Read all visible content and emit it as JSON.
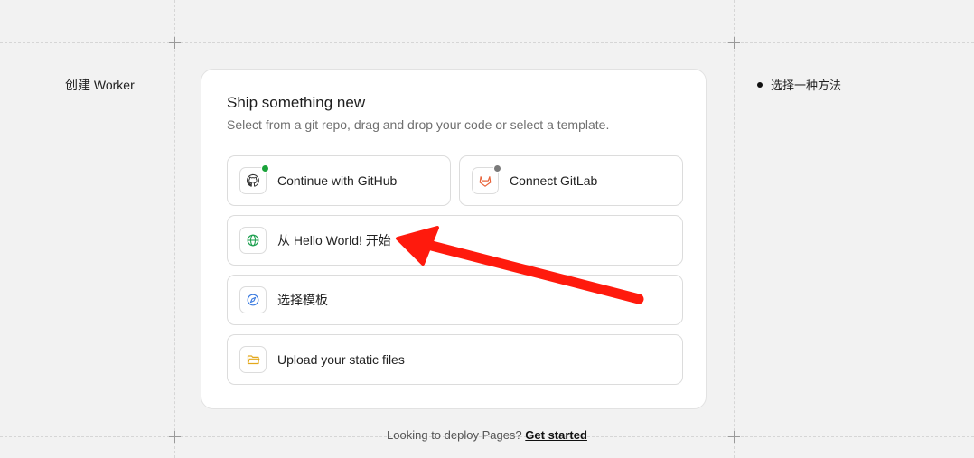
{
  "sidebar_left": {
    "label": "创建 Worker"
  },
  "steps": {
    "current": "选择一种方法"
  },
  "card": {
    "title": "Ship something new",
    "subtitle": "Select from a git repo, drag and drop your code or select a template.",
    "options": {
      "github": {
        "label": "Continue with GitHub",
        "icon": "github-icon",
        "status_color": "#1aa33a"
      },
      "gitlab": {
        "label": "Connect GitLab",
        "icon": "gitlab-icon",
        "status_color": "#7a7a7a"
      },
      "hello_world": {
        "label": "从 Hello World! 开始",
        "icon": "globe-icon"
      },
      "template": {
        "label": "选择模板",
        "icon": "compass-icon"
      },
      "upload": {
        "label": "Upload your static files",
        "icon": "folder-icon"
      }
    }
  },
  "footer": {
    "text": "Looking to deploy Pages?",
    "link": "Get started"
  },
  "colors": {
    "annotation_arrow": "#ff1a0d",
    "globe": "#21a152",
    "compass": "#3b7be0",
    "folder": "#e3a81b",
    "gitlab": "#e8633a"
  }
}
